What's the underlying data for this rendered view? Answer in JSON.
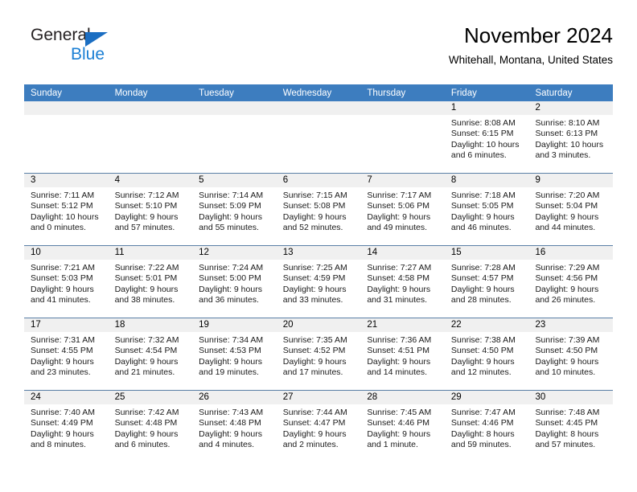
{
  "brand": {
    "name_top": "General",
    "name_bottom": "Blue",
    "triangle_color": "#1b6ec2",
    "blue_color": "#1b7fd4"
  },
  "header": {
    "title": "November 2024",
    "subtitle": "Whitehall, Montana, United States"
  },
  "theme": {
    "header_blue": "#3d7dbf",
    "row_divider": "#5a7fa6",
    "day_band_gray": "#f0f0f0"
  },
  "weekdays": [
    "Sunday",
    "Monday",
    "Tuesday",
    "Wednesday",
    "Thursday",
    "Friday",
    "Saturday"
  ],
  "labels": {
    "sunrise": "Sunrise:",
    "sunset": "Sunset:",
    "daylight": "Daylight:"
  },
  "weeks": [
    [
      {
        "day": "",
        "sunrise": "",
        "sunset": "",
        "daylight_a": "",
        "daylight_b": ""
      },
      {
        "day": "",
        "sunrise": "",
        "sunset": "",
        "daylight_a": "",
        "daylight_b": ""
      },
      {
        "day": "",
        "sunrise": "",
        "sunset": "",
        "daylight_a": "",
        "daylight_b": ""
      },
      {
        "day": "",
        "sunrise": "",
        "sunset": "",
        "daylight_a": "",
        "daylight_b": ""
      },
      {
        "day": "",
        "sunrise": "",
        "sunset": "",
        "daylight_a": "",
        "daylight_b": ""
      },
      {
        "day": "1",
        "sunrise": "Sunrise: 8:08 AM",
        "sunset": "Sunset: 6:15 PM",
        "daylight_a": "Daylight: 10 hours",
        "daylight_b": "and 6 minutes."
      },
      {
        "day": "2",
        "sunrise": "Sunrise: 8:10 AM",
        "sunset": "Sunset: 6:13 PM",
        "daylight_a": "Daylight: 10 hours",
        "daylight_b": "and 3 minutes."
      }
    ],
    [
      {
        "day": "3",
        "sunrise": "Sunrise: 7:11 AM",
        "sunset": "Sunset: 5:12 PM",
        "daylight_a": "Daylight: 10 hours",
        "daylight_b": "and 0 minutes."
      },
      {
        "day": "4",
        "sunrise": "Sunrise: 7:12 AM",
        "sunset": "Sunset: 5:10 PM",
        "daylight_a": "Daylight: 9 hours",
        "daylight_b": "and 57 minutes."
      },
      {
        "day": "5",
        "sunrise": "Sunrise: 7:14 AM",
        "sunset": "Sunset: 5:09 PM",
        "daylight_a": "Daylight: 9 hours",
        "daylight_b": "and 55 minutes."
      },
      {
        "day": "6",
        "sunrise": "Sunrise: 7:15 AM",
        "sunset": "Sunset: 5:08 PM",
        "daylight_a": "Daylight: 9 hours",
        "daylight_b": "and 52 minutes."
      },
      {
        "day": "7",
        "sunrise": "Sunrise: 7:17 AM",
        "sunset": "Sunset: 5:06 PM",
        "daylight_a": "Daylight: 9 hours",
        "daylight_b": "and 49 minutes."
      },
      {
        "day": "8",
        "sunrise": "Sunrise: 7:18 AM",
        "sunset": "Sunset: 5:05 PM",
        "daylight_a": "Daylight: 9 hours",
        "daylight_b": "and 46 minutes."
      },
      {
        "day": "9",
        "sunrise": "Sunrise: 7:20 AM",
        "sunset": "Sunset: 5:04 PM",
        "daylight_a": "Daylight: 9 hours",
        "daylight_b": "and 44 minutes."
      }
    ],
    [
      {
        "day": "10",
        "sunrise": "Sunrise: 7:21 AM",
        "sunset": "Sunset: 5:03 PM",
        "daylight_a": "Daylight: 9 hours",
        "daylight_b": "and 41 minutes."
      },
      {
        "day": "11",
        "sunrise": "Sunrise: 7:22 AM",
        "sunset": "Sunset: 5:01 PM",
        "daylight_a": "Daylight: 9 hours",
        "daylight_b": "and 38 minutes."
      },
      {
        "day": "12",
        "sunrise": "Sunrise: 7:24 AM",
        "sunset": "Sunset: 5:00 PM",
        "daylight_a": "Daylight: 9 hours",
        "daylight_b": "and 36 minutes."
      },
      {
        "day": "13",
        "sunrise": "Sunrise: 7:25 AM",
        "sunset": "Sunset: 4:59 PM",
        "daylight_a": "Daylight: 9 hours",
        "daylight_b": "and 33 minutes."
      },
      {
        "day": "14",
        "sunrise": "Sunrise: 7:27 AM",
        "sunset": "Sunset: 4:58 PM",
        "daylight_a": "Daylight: 9 hours",
        "daylight_b": "and 31 minutes."
      },
      {
        "day": "15",
        "sunrise": "Sunrise: 7:28 AM",
        "sunset": "Sunset: 4:57 PM",
        "daylight_a": "Daylight: 9 hours",
        "daylight_b": "and 28 minutes."
      },
      {
        "day": "16",
        "sunrise": "Sunrise: 7:29 AM",
        "sunset": "Sunset: 4:56 PM",
        "daylight_a": "Daylight: 9 hours",
        "daylight_b": "and 26 minutes."
      }
    ],
    [
      {
        "day": "17",
        "sunrise": "Sunrise: 7:31 AM",
        "sunset": "Sunset: 4:55 PM",
        "daylight_a": "Daylight: 9 hours",
        "daylight_b": "and 23 minutes."
      },
      {
        "day": "18",
        "sunrise": "Sunrise: 7:32 AM",
        "sunset": "Sunset: 4:54 PM",
        "daylight_a": "Daylight: 9 hours",
        "daylight_b": "and 21 minutes."
      },
      {
        "day": "19",
        "sunrise": "Sunrise: 7:34 AM",
        "sunset": "Sunset: 4:53 PM",
        "daylight_a": "Daylight: 9 hours",
        "daylight_b": "and 19 minutes."
      },
      {
        "day": "20",
        "sunrise": "Sunrise: 7:35 AM",
        "sunset": "Sunset: 4:52 PM",
        "daylight_a": "Daylight: 9 hours",
        "daylight_b": "and 17 minutes."
      },
      {
        "day": "21",
        "sunrise": "Sunrise: 7:36 AM",
        "sunset": "Sunset: 4:51 PM",
        "daylight_a": "Daylight: 9 hours",
        "daylight_b": "and 14 minutes."
      },
      {
        "day": "22",
        "sunrise": "Sunrise: 7:38 AM",
        "sunset": "Sunset: 4:50 PM",
        "daylight_a": "Daylight: 9 hours",
        "daylight_b": "and 12 minutes."
      },
      {
        "day": "23",
        "sunrise": "Sunrise: 7:39 AM",
        "sunset": "Sunset: 4:50 PM",
        "daylight_a": "Daylight: 9 hours",
        "daylight_b": "and 10 minutes."
      }
    ],
    [
      {
        "day": "24",
        "sunrise": "Sunrise: 7:40 AM",
        "sunset": "Sunset: 4:49 PM",
        "daylight_a": "Daylight: 9 hours",
        "daylight_b": "and 8 minutes."
      },
      {
        "day": "25",
        "sunrise": "Sunrise: 7:42 AM",
        "sunset": "Sunset: 4:48 PM",
        "daylight_a": "Daylight: 9 hours",
        "daylight_b": "and 6 minutes."
      },
      {
        "day": "26",
        "sunrise": "Sunrise: 7:43 AM",
        "sunset": "Sunset: 4:48 PM",
        "daylight_a": "Daylight: 9 hours",
        "daylight_b": "and 4 minutes."
      },
      {
        "day": "27",
        "sunrise": "Sunrise: 7:44 AM",
        "sunset": "Sunset: 4:47 PM",
        "daylight_a": "Daylight: 9 hours",
        "daylight_b": "and 2 minutes."
      },
      {
        "day": "28",
        "sunrise": "Sunrise: 7:45 AM",
        "sunset": "Sunset: 4:46 PM",
        "daylight_a": "Daylight: 9 hours",
        "daylight_b": "and 1 minute."
      },
      {
        "day": "29",
        "sunrise": "Sunrise: 7:47 AM",
        "sunset": "Sunset: 4:46 PM",
        "daylight_a": "Daylight: 8 hours",
        "daylight_b": "and 59 minutes."
      },
      {
        "day": "30",
        "sunrise": "Sunrise: 7:48 AM",
        "sunset": "Sunset: 4:45 PM",
        "daylight_a": "Daylight: 8 hours",
        "daylight_b": "and 57 minutes."
      }
    ]
  ]
}
